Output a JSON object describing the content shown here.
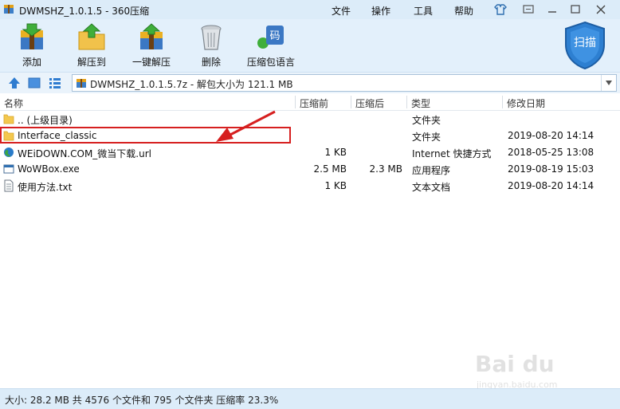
{
  "window": {
    "title": "DWMSHZ_1.0.1.5 - 360压缩",
    "menus": [
      "文件",
      "操作",
      "工具",
      "帮助"
    ]
  },
  "toolbar": {
    "tools": [
      {
        "label": "添加",
        "icon": "add-archive-icon"
      },
      {
        "label": "解压到",
        "icon": "extract-to-icon"
      },
      {
        "label": "一键解压",
        "icon": "one-click-extract-icon"
      },
      {
        "label": "删除",
        "icon": "delete-trash-icon"
      },
      {
        "label": "压缩包语言",
        "icon": "archive-language-icon"
      }
    ],
    "language_badge": "码",
    "scan_label": "扫描"
  },
  "address": {
    "path": "DWMSHZ_1.0.1.5.7z - 解包大小为 121.1 MB"
  },
  "columns": {
    "name": "名称",
    "before": "压缩前",
    "after": "压缩后",
    "type": "类型",
    "date": "修改日期"
  },
  "files": [
    {
      "name": ".. (上级目录)",
      "before": "",
      "after": "",
      "type": "文件夹",
      "date": "",
      "icon": "folder-up-icon"
    },
    {
      "name": "Interface_classic",
      "before": "",
      "after": "",
      "type": "文件夹",
      "date": "2019-08-20 14:14",
      "icon": "folder-icon"
    },
    {
      "name": "WEiDOWN.COM_微当下载.url",
      "before": "1 KB",
      "after": "",
      "type": "Internet 快捷方式",
      "date": "2018-05-25 13:08",
      "icon": "globe-url-icon"
    },
    {
      "name": "WoWBox.exe",
      "before": "2.5 MB",
      "after": "2.3 MB",
      "type": "应用程序",
      "date": "2019-08-19 15:03",
      "icon": "exe-window-icon"
    },
    {
      "name": "使用方法.txt",
      "before": "1 KB",
      "after": "",
      "type": "文本文档",
      "date": "2019-08-20 14:14",
      "icon": "text-file-icon"
    }
  ],
  "status": {
    "text": "大小: 28.2 MB 共 4576 个文件和 795 个文件夹 压缩率 23.3%"
  },
  "watermark": {
    "brand": "Bai du",
    "sub": "jingyan.baidu.com"
  },
  "colors": {
    "accent": "#2e7fd2",
    "annotation": "#d61f1f"
  }
}
